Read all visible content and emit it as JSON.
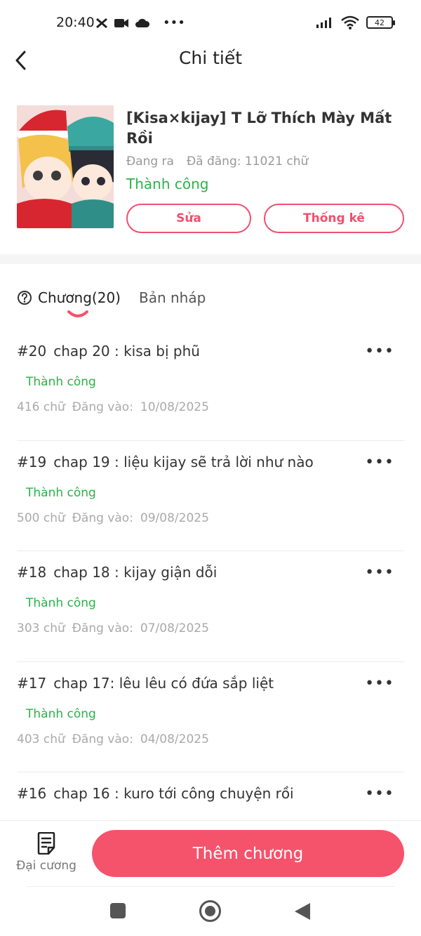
{
  "status_bar": {
    "time": "20:40",
    "battery": "42"
  },
  "header": {
    "title": "Chi tiết"
  },
  "book": {
    "title": "[Kisa×kijay] T Lỡ Thích Mày Mất Rồi",
    "state": "Đang ra",
    "posted": "Đã đăng: 11021 chữ",
    "status": "Thành công",
    "edit_label": "Sửa",
    "stats_label": "Thống kê"
  },
  "tabs": [
    {
      "label": "Chương(20)",
      "active": true
    },
    {
      "label": "Bản nháp",
      "active": false
    }
  ],
  "chapters": [
    {
      "num": "#20",
      "title": "chap 20 : kisa bị phũ",
      "status": "Thành công",
      "words": "416 chữ",
      "posted_label": "Đăng vào:",
      "date": "10/08/2025"
    },
    {
      "num": "#19",
      "title": "chap 19 : liệu kijay sẽ trả lời như nào",
      "status": "Thành công",
      "words": "500 chữ",
      "posted_label": "Đăng vào:",
      "date": "09/08/2025"
    },
    {
      "num": "#18",
      "title": "chap 18 : kijay giận dỗi",
      "status": "Thành công",
      "words": "303 chữ",
      "posted_label": "Đăng vào:",
      "date": "07/08/2025"
    },
    {
      "num": "#17",
      "title": "chap 17: lêu lêu có đứa sắp liệt",
      "status": "Thành công",
      "words": "403 chữ",
      "posted_label": "Đăng vào:",
      "date": "04/08/2025"
    },
    {
      "num": "#16",
      "title": "chap 16 : kuro tới công chuyện rồi",
      "status": "",
      "words": "",
      "posted_label": "",
      "date": ""
    }
  ],
  "bottom": {
    "outline_label": "Đại cương",
    "add_label": "Thêm chương"
  },
  "colors": {
    "accent": "#f5536b",
    "success": "#2bb24c",
    "outline_button": "#f0506e"
  },
  "icons": {
    "back": "chevron-left-icon",
    "more": "more-horizontal-icon",
    "help": "question-circle-icon",
    "outline": "document-icon"
  }
}
